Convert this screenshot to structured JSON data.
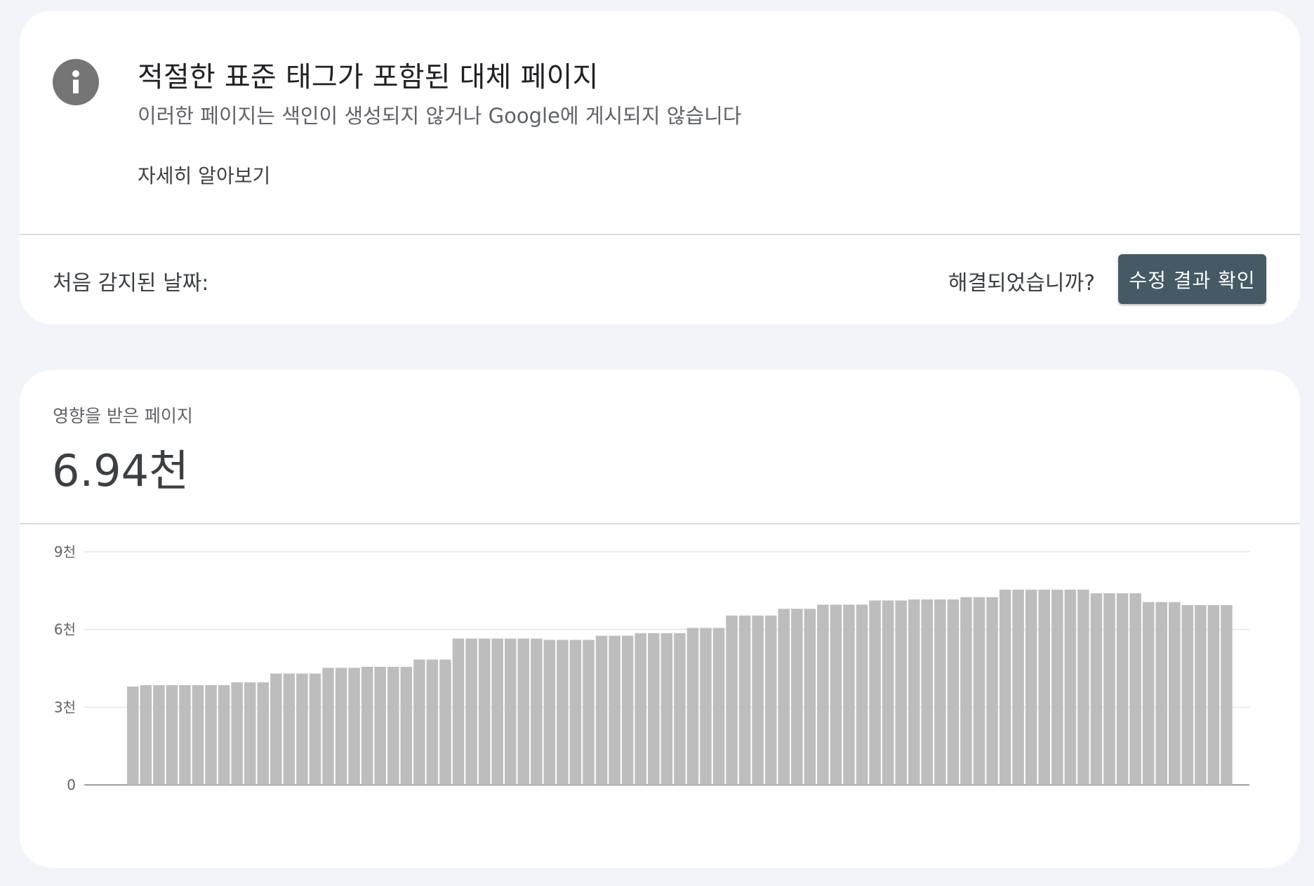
{
  "issue": {
    "title": "적절한 표준 태그가 포함된 대체 페이지",
    "subtitle": "이러한 페이지는 색인이 생성되지 않거나 Google에 게시되지 않습니다",
    "learn_more": "자세히 알아보기",
    "first_detected_label": "처음 감지된 날짜:",
    "resolved_question": "해결되었습니까?",
    "validate_button": "수정 결과 확인",
    "icon": "info-icon"
  },
  "affected": {
    "label": "영향을 받은 페이지",
    "value": "6.94천"
  },
  "colors": {
    "background": "#f1f5fa",
    "card": "#ffffff",
    "bar": "#bdbdbd",
    "button": "#455a64",
    "icon": "#757575"
  },
  "chart_data": {
    "type": "bar",
    "y_ticks": [
      {
        "value": 0,
        "label": "0"
      },
      {
        "value": 3000,
        "label": "3천"
      },
      {
        "value": 6000,
        "label": "6천"
      },
      {
        "value": 9000,
        "label": "9천"
      }
    ],
    "ylim": [
      0,
      9000
    ],
    "grid": true,
    "values": [
      3800,
      3850,
      3850,
      3850,
      3850,
      3850,
      3850,
      3850,
      3960,
      3960,
      3960,
      4300,
      4300,
      4300,
      4300,
      4520,
      4520,
      4520,
      4560,
      4560,
      4560,
      4560,
      4840,
      4840,
      4840,
      5650,
      5650,
      5650,
      5650,
      5650,
      5650,
      5650,
      5600,
      5600,
      5600,
      5600,
      5760,
      5760,
      5760,
      5860,
      5860,
      5860,
      5860,
      6060,
      6060,
      6060,
      6540,
      6540,
      6540,
      6540,
      6800,
      6800,
      6800,
      6960,
      6960,
      6960,
      6960,
      7120,
      7120,
      7120,
      7160,
      7160,
      7160,
      7160,
      7250,
      7250,
      7250,
      7540,
      7540,
      7540,
      7540,
      7540,
      7540,
      7540,
      7400,
      7400,
      7400,
      7400,
      7060,
      7060,
      7060,
      6940,
      6940,
      6940,
      6940
    ]
  }
}
